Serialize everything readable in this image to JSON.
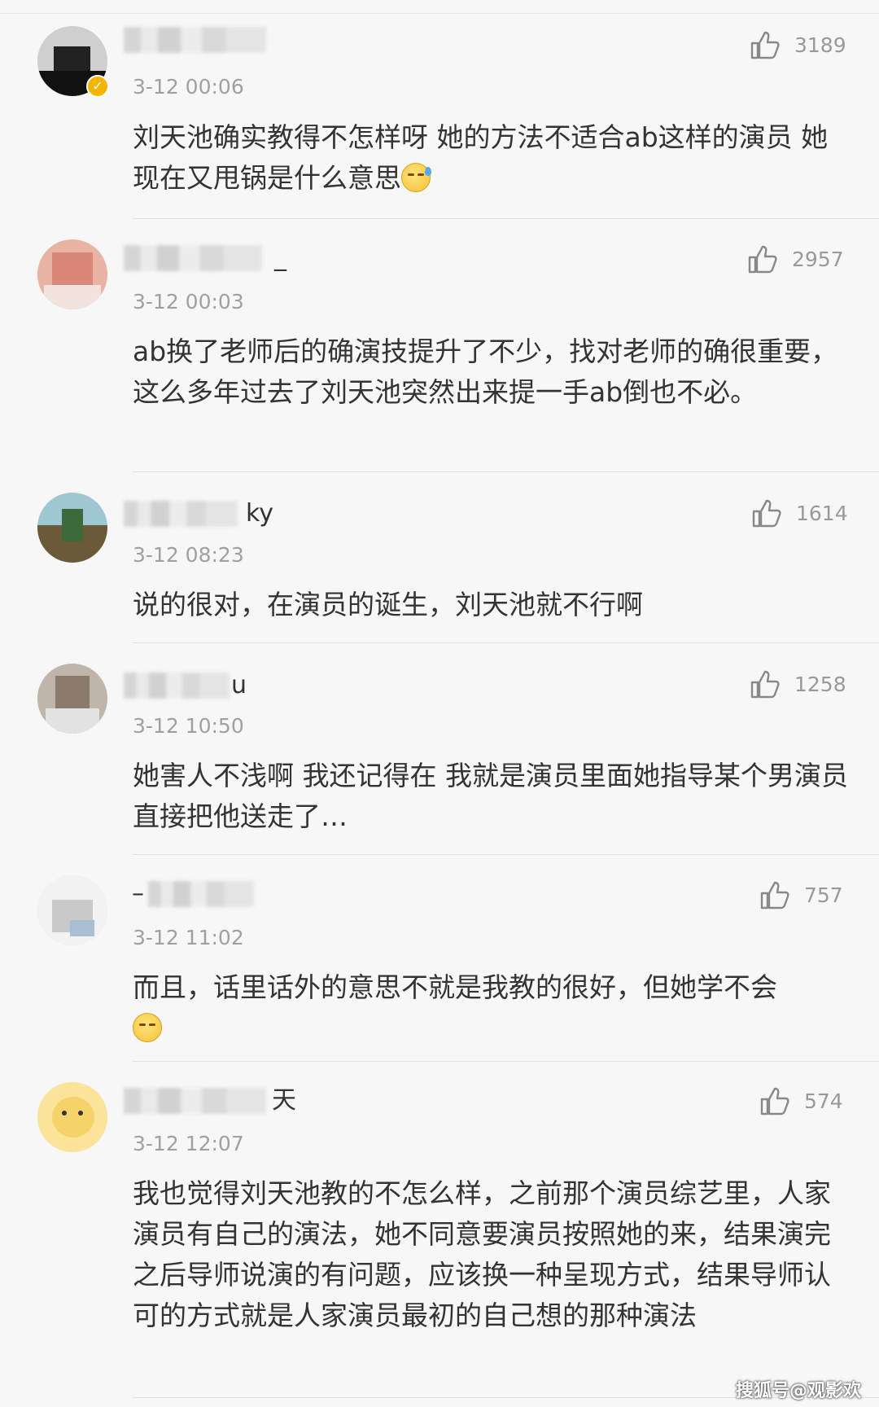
{
  "comments": [
    {
      "name_suffix": "",
      "time": "3-12 00:06",
      "likes": "3189",
      "text": "刘天池确实教得不怎样呀 她的方法不适合ab这样的演员 她现在又甩锅是什么意思",
      "emoji": "sweat-face-icon",
      "verified": true
    },
    {
      "name_suffix": "_",
      "time": "3-12 00:03",
      "likes": "2957",
      "text": "ab换了老师后的确演技提升了不少，找对老师的确很重要，这么多年过去了刘天池突然出来提一手ab倒也不必。",
      "emoji": ""
    },
    {
      "name_suffix": "ky",
      "time": "3-12 08:23",
      "likes": "1614",
      "text": "说的很对，在演员的诞生，刘天池就不行啊",
      "emoji": ""
    },
    {
      "name_suffix": "u",
      "time": "3-12 10:50",
      "likes": "1258",
      "text": "她害人不浅啊 我还记得在 我就是演员里面她指导某个男演员直接把他送走了…",
      "emoji": ""
    },
    {
      "name_suffix": "–",
      "time": "3-12 11:02",
      "likes": "757",
      "text": "而且，话里话外的意思不就是我教的很好，但她学不会",
      "emoji": "eye-roll-face-icon"
    },
    {
      "name_suffix": "天",
      "time": "3-12 12:07",
      "likes": "574",
      "text": "我也觉得刘天池教的不怎么样，之前那个演员综艺里，人家演员有自己的演法，她不同意要演员按照她的来，结果演完之后导师说演的有问题，应该换一种呈现方式，结果导师认可的方式就是人家演员最初的自己想的那种演法",
      "emoji": ""
    }
  ],
  "watermark": "搜狐号@观影欢",
  "colors": {
    "text": "#333333",
    "meta": "#a0a0a0",
    "background": "#f7f7f7"
  }
}
